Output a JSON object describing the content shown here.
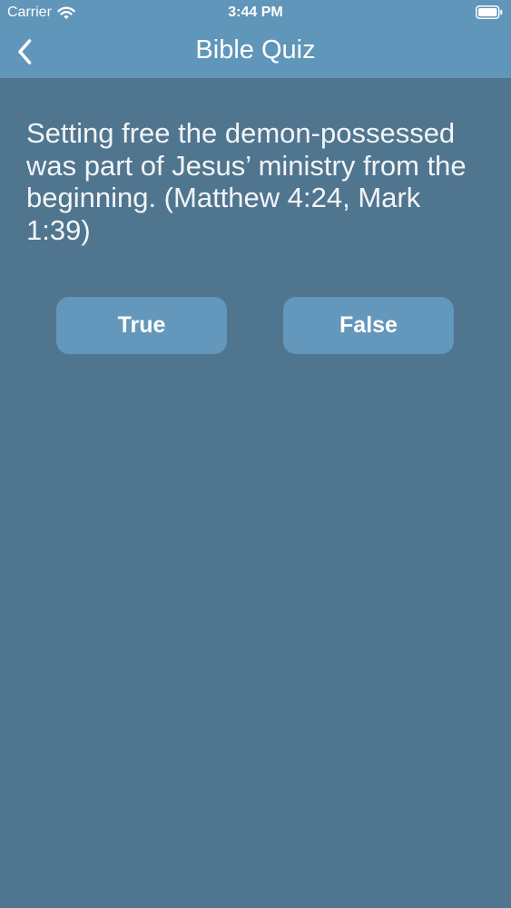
{
  "status_bar": {
    "carrier": "Carrier",
    "time": "3:44 PM",
    "icons": [
      "wifi-icon",
      "battery-icon"
    ]
  },
  "nav": {
    "title": "Bible Quiz",
    "back_icon": "chevron-left-icon"
  },
  "quiz": {
    "question": "Setting free the demon-possessed was part of Jesus’ ministry from the beginning. (Matthew 4:24, Mark 1:39)",
    "answers": [
      {
        "label": "True"
      },
      {
        "label": "False"
      }
    ]
  },
  "colors": {
    "background": "#50758f",
    "header": "#6096b9",
    "button": "#6397bb",
    "text": "#ffffff"
  }
}
